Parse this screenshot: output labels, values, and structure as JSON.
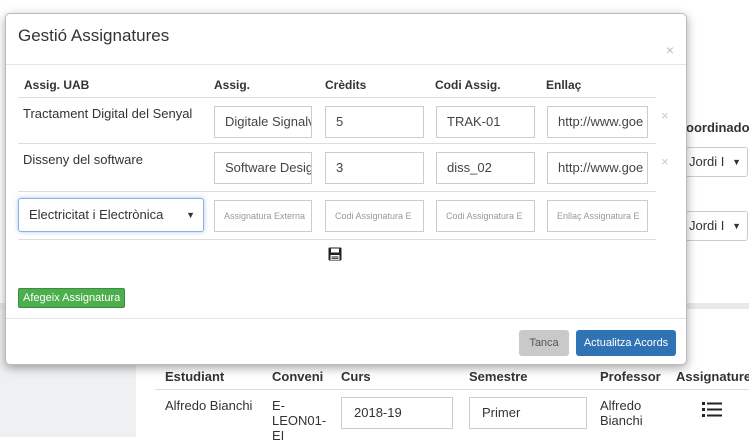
{
  "modal": {
    "title": "Gestió Assignatures",
    "close_glyph": "×",
    "headers": [
      "Assig. UAB",
      "Assig.",
      "Crèdits",
      "Codi Assig.",
      "Enllaç"
    ],
    "rows": [
      {
        "assig_uab": "Tractament Digital del Senyal",
        "assig": "Digitale Signalv",
        "credits": "5",
        "codi": "TRAK-01",
        "enllac": "http://www.goe",
        "remove": "×"
      },
      {
        "assig_uab": "Disseny del software",
        "assig": "Software Desig",
        "credits": "3",
        "codi": "diss_02",
        "enllac": "http://www.goe",
        "remove": "×"
      }
    ],
    "new_row": {
      "select_value": "Electricitat i Electrònica",
      "assig_placeholder": "Assignatura Externa",
      "credits_placeholder": "Codi Assignatura E",
      "codi_placeholder": "Codi Assignatura E",
      "enllac_placeholder": "Enllaç Assignatura E"
    },
    "add_button": "Afegeix Assignatura",
    "cancel_button": "Tanca",
    "update_button": "Actualitza Acords"
  },
  "background": {
    "coordinator_header": "oordinador",
    "coordinator_values": [
      "Jordi I",
      "Jordi I"
    ],
    "table_headers": [
      "Estudiant",
      "Conveni",
      "Curs",
      "Semestre",
      "Professor",
      "Assignatures"
    ],
    "row": {
      "estudiant": "Alfredo Bianchi",
      "conveni_lines": [
        "E-",
        "LEON01-",
        "EI"
      ],
      "curs": "2018-19",
      "semestre": "Primer",
      "professor_lines": [
        "Alfredo",
        "Bianchi"
      ]
    }
  },
  "colors": {
    "add_button": "#4cae4c",
    "update_button": "#2f73b5",
    "cancel_button": "#c9c9c9"
  }
}
